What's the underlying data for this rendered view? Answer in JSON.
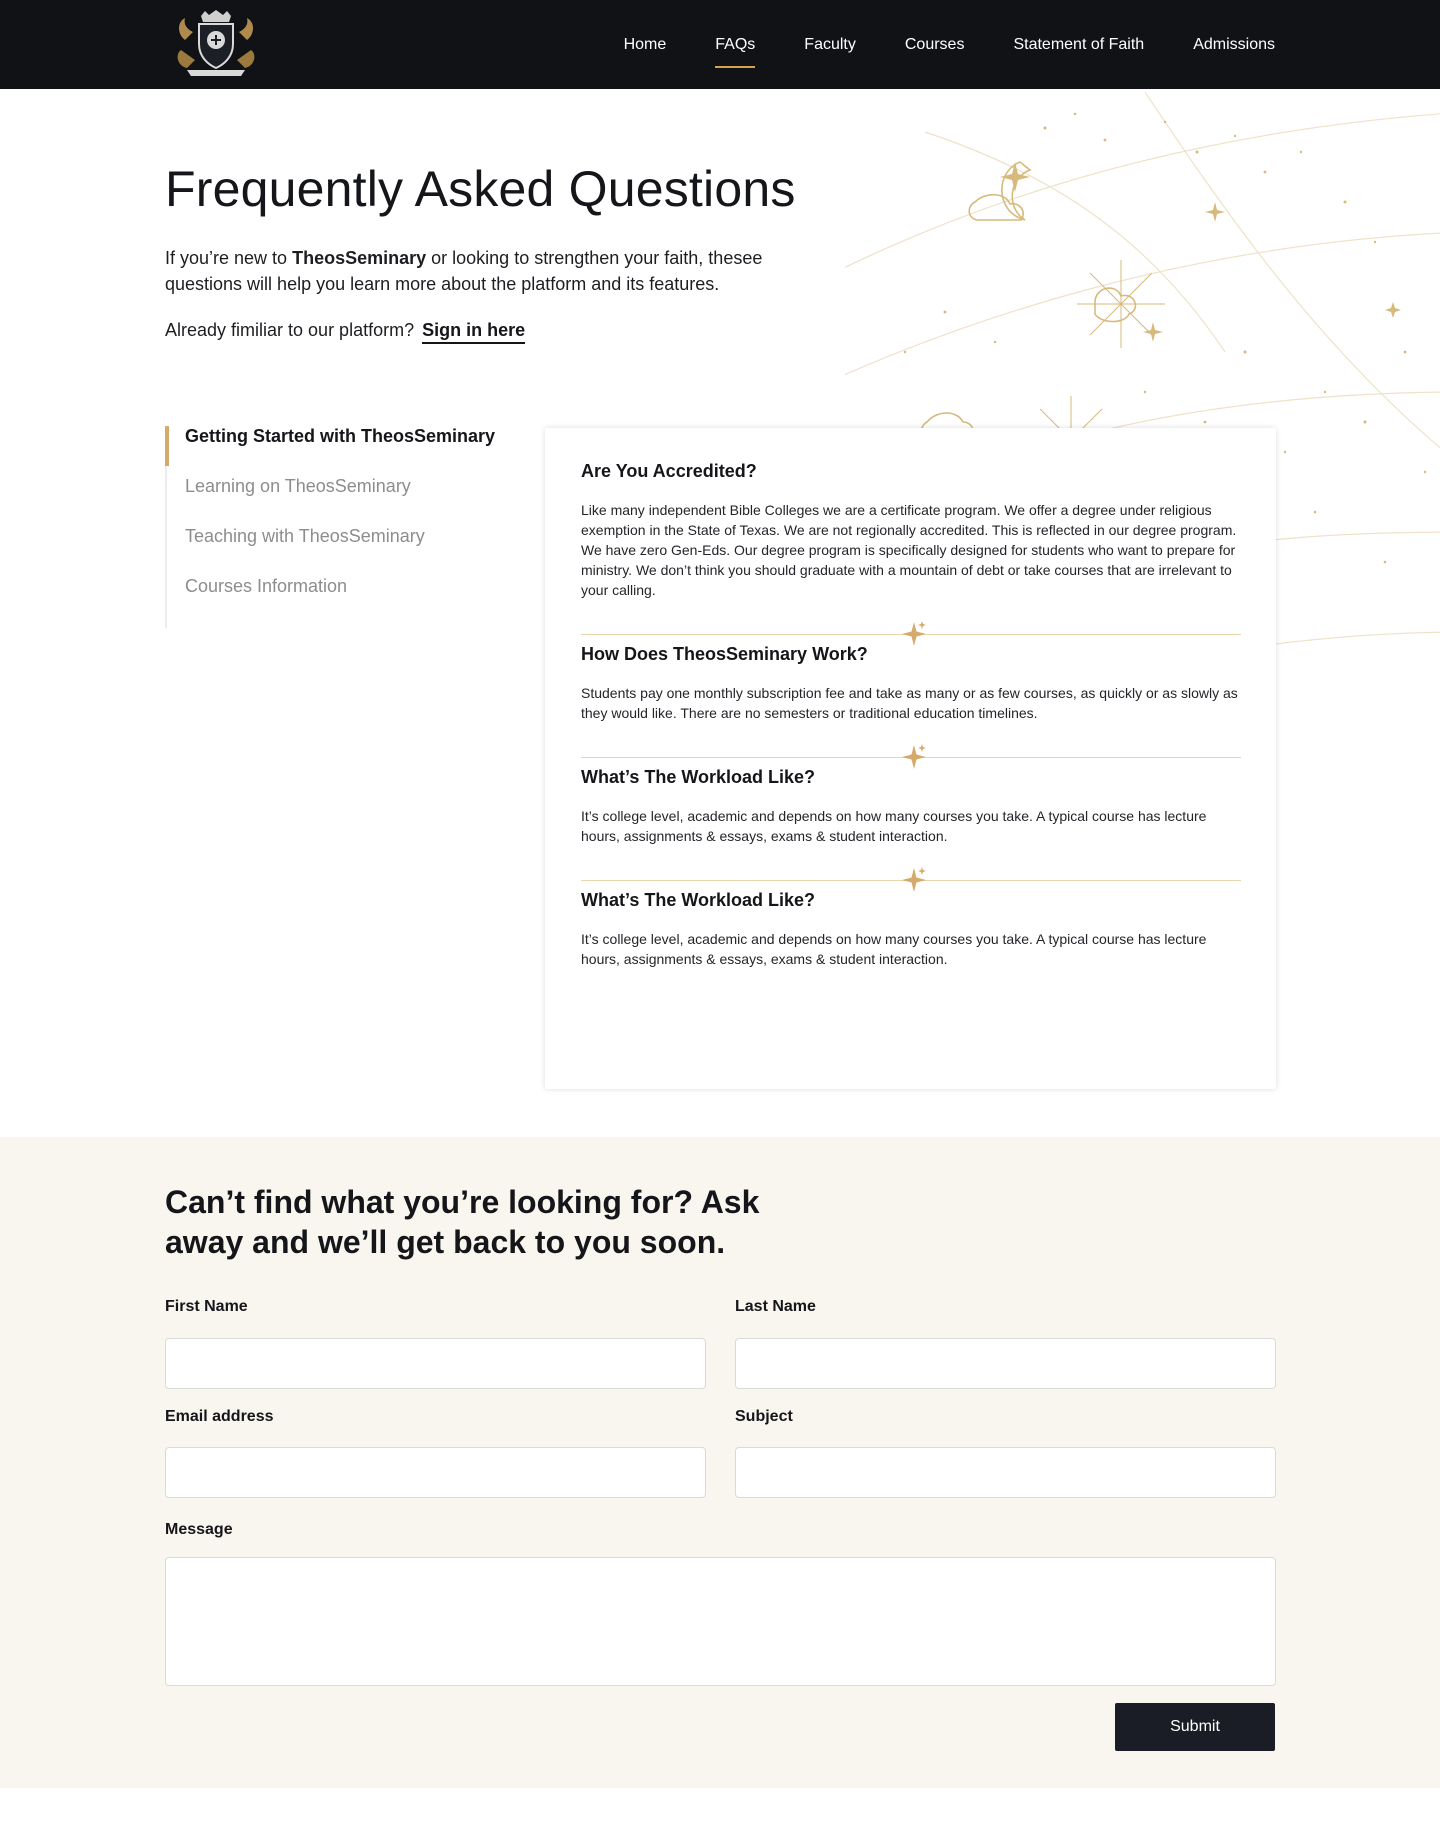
{
  "nav": {
    "logo_name": "crest-logo",
    "links": [
      {
        "label": "Home",
        "active": false
      },
      {
        "label": "FAQs",
        "active": true
      },
      {
        "label": "Faculty",
        "active": false
      },
      {
        "label": "Courses",
        "active": false
      },
      {
        "label": "Statement of Faith",
        "active": false
      },
      {
        "label": "Admissions",
        "active": false
      }
    ]
  },
  "hero": {
    "title": "Frequently Asked Questions",
    "intro_before": "If you’re new to ",
    "intro_brand": "TheosSeminary",
    "intro_after": " or looking to strengthen your faith, thesee questions will help you learn more about the platform and its features.",
    "signin_prompt": "Already fimiliar to our platform?",
    "signin_link": "Sign in here"
  },
  "side_nav": {
    "items": [
      {
        "label": "Getting Started with TheosSeminary",
        "active": true
      },
      {
        "label": "Learning on TheosSeminary",
        "active": false
      },
      {
        "label": "Teaching with TheosSeminary",
        "active": false
      },
      {
        "label": "Courses Information",
        "active": false
      }
    ]
  },
  "faqs": [
    {
      "question": "Are You Accredited?",
      "answer": "Like many independent Bible Colleges we are a certificate program. We offer a degree under religious exemption in the State of Texas. We are not regionally accredited. This is reflected in our degree program. We have zero Gen-Eds. Our degree program is specifically designed for students who want to prepare for ministry. We don’t think you should graduate with a mountain of debt or take courses that are irrelevant to your calling."
    },
    {
      "question": "How Does TheosSeminary Work?",
      "answer": "Students pay one monthly subscription fee and take as many or as few courses, as quickly or as slowly as they would like. There are no semesters or traditional education timelines."
    },
    {
      "question": "What’s The Workload Like?",
      "answer": "It’s college level, academic and depends on how many courses you take. A typical course has lecture hours, assignments & essays, exams & student interaction."
    },
    {
      "question": "What’s The Workload Like?",
      "answer": "It’s college level, academic and depends on how many courses you take. A typical course has lecture hours, assignments & essays, exams & student interaction."
    }
  ],
  "contact": {
    "title": "Can’t find what you’re looking for? Ask away and we’ll get back to you soon.",
    "first_name_label": "First Name",
    "last_name_label": "Last Name",
    "email_label": "Email address",
    "subject_label": "Subject",
    "message_label": "Message",
    "submit_label": "Submit"
  },
  "colors": {
    "nav_bg": "#101216",
    "accent_gold": "#d4a24c",
    "contact_bg": "#f9f6ef",
    "button_bg": "#1b1d26"
  }
}
